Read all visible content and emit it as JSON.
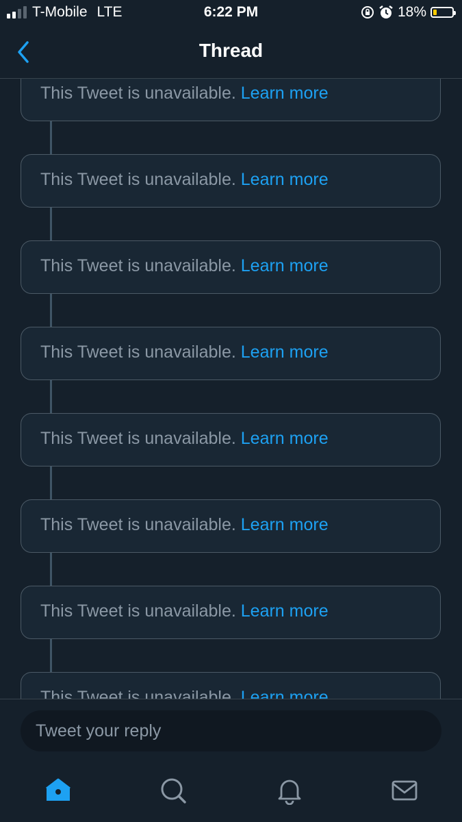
{
  "status_bar": {
    "carrier": "T-Mobile",
    "network": "LTE",
    "time": "6:22 PM",
    "battery_percent": "18%",
    "battery_level": 0.18,
    "icons": [
      "signal-icon",
      "orientation-lock-icon",
      "alarm-icon",
      "battery-icon"
    ]
  },
  "header": {
    "title": "Thread",
    "back_icon": "chevron-left-icon"
  },
  "thread": {
    "items": [
      {
        "text": "This Tweet is unavailable.",
        "link": "Learn more"
      },
      {
        "text": "This Tweet is unavailable.",
        "link": "Learn more"
      },
      {
        "text": "This Tweet is unavailable.",
        "link": "Learn more"
      },
      {
        "text": "This Tweet is unavailable.",
        "link": "Learn more"
      },
      {
        "text": "This Tweet is unavailable.",
        "link": "Learn more"
      },
      {
        "text": "This Tweet is unavailable.",
        "link": "Learn more"
      },
      {
        "text": "This Tweet is unavailable.",
        "link": "Learn more"
      },
      {
        "text": "This Tweet is unavailable.",
        "link": "Learn more"
      }
    ]
  },
  "reply": {
    "placeholder": "Tweet your reply"
  },
  "tab_bar": {
    "tabs": [
      "home-icon",
      "search-icon",
      "notifications-icon",
      "messages-icon"
    ],
    "active": "home-icon"
  },
  "colors": {
    "background": "#15202b",
    "accent": "#1da1f2",
    "muted_text": "#8b98a5",
    "border": "#4c5a66"
  }
}
